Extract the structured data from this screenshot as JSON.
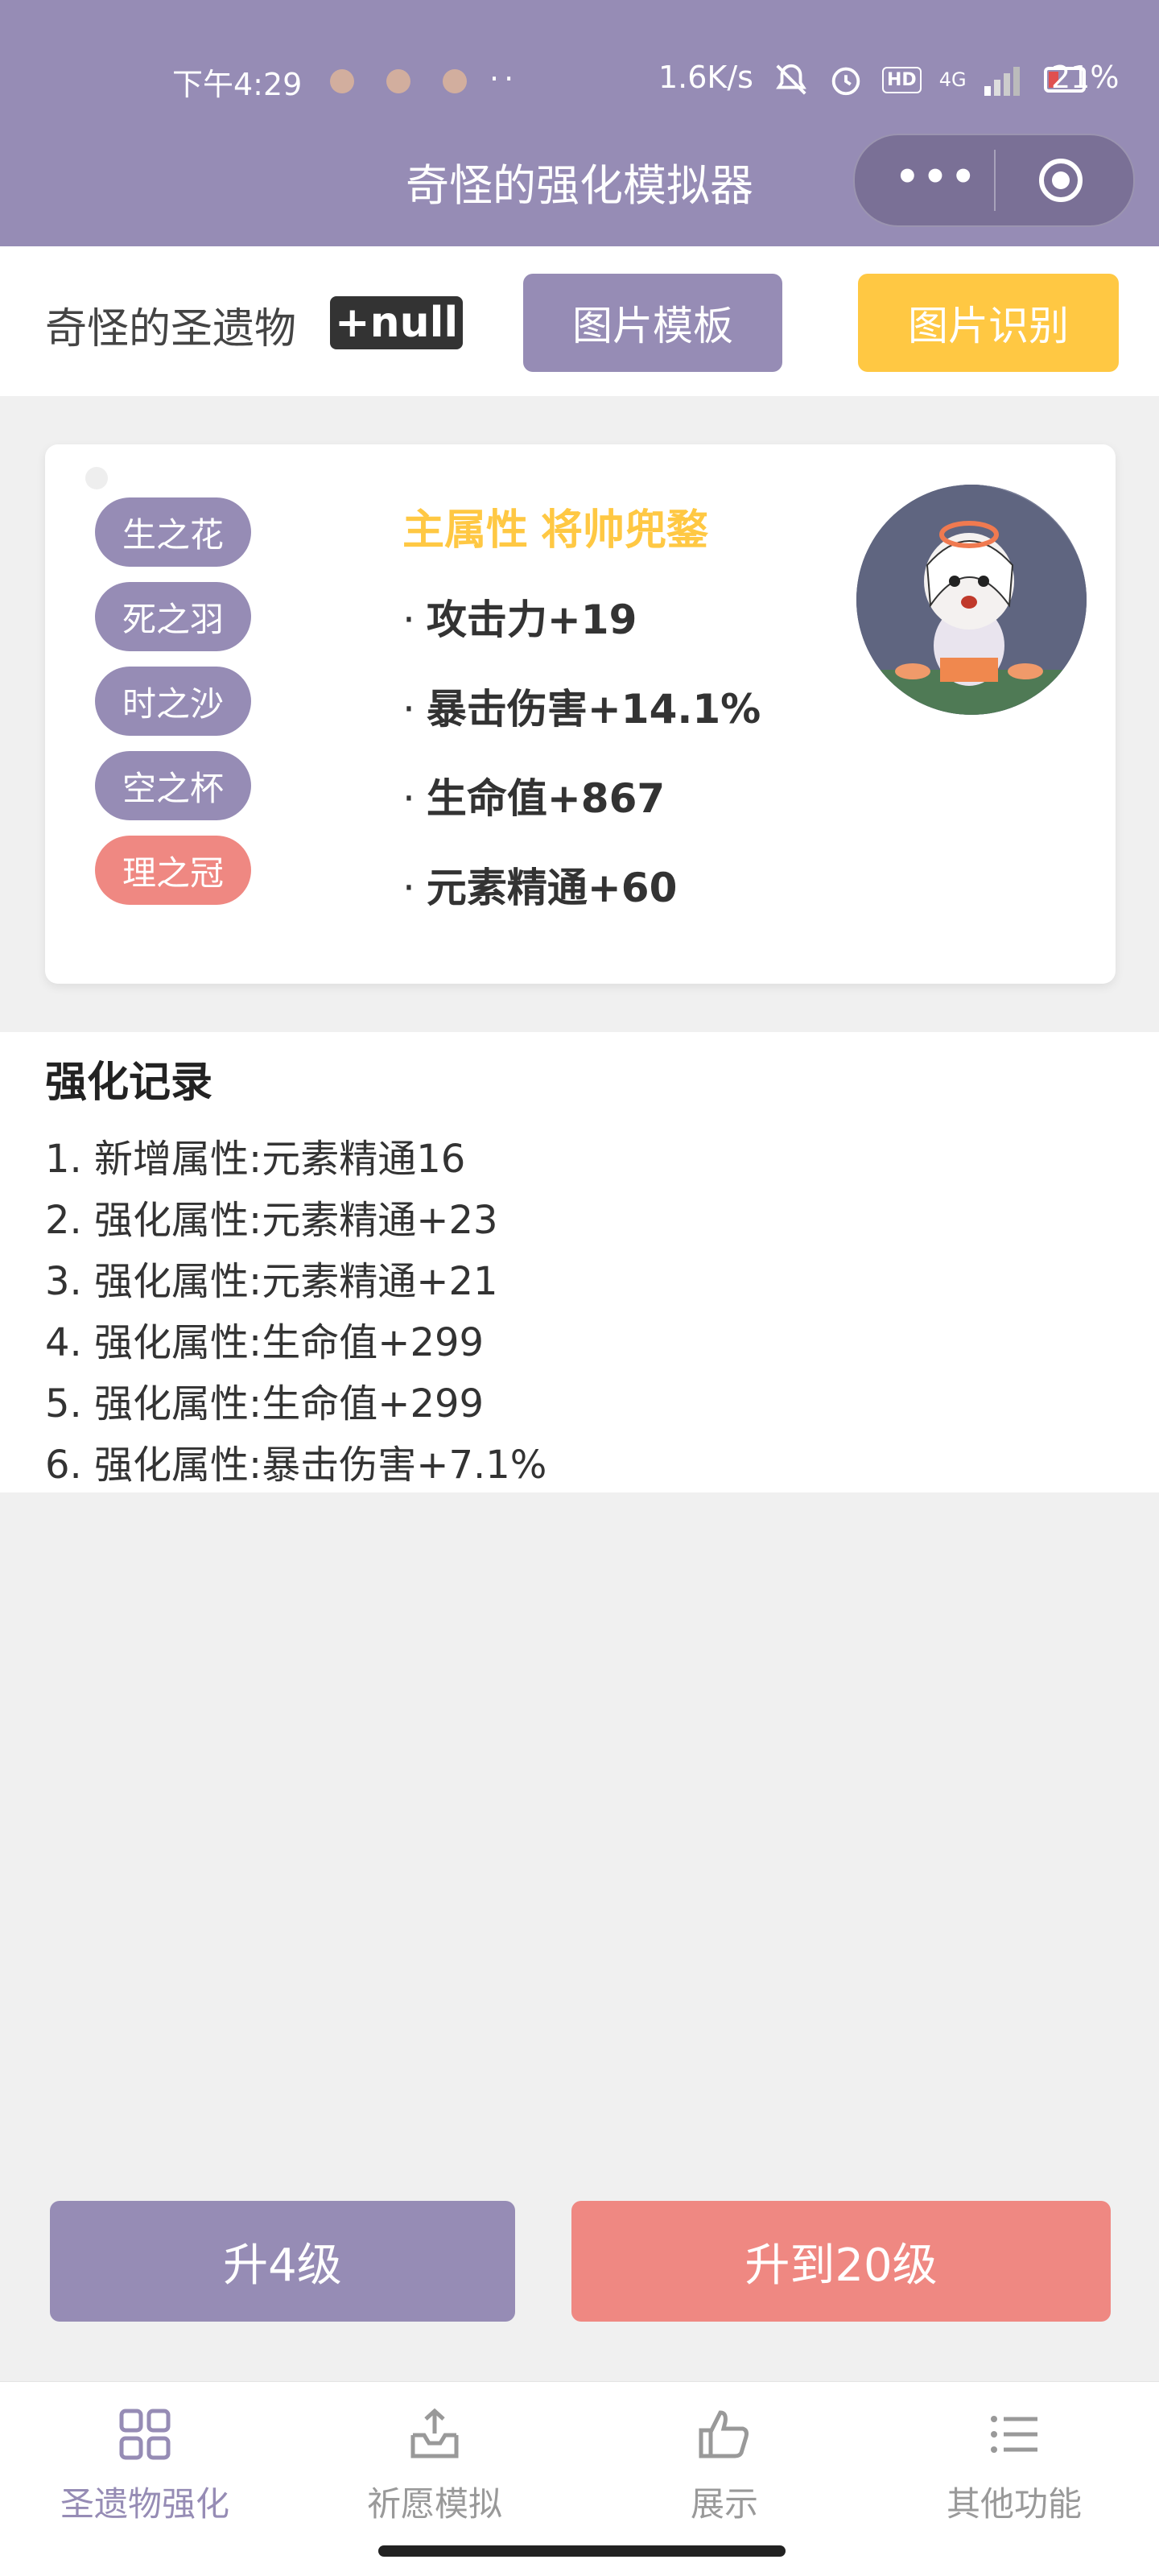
{
  "status_bar": {
    "time": "下午4:29",
    "more": "··",
    "net_speed": "1.6K/s",
    "signal_label": "4G",
    "hd_label": "HD",
    "battery": "21%"
  },
  "nav": {
    "title": "奇怪的强化模拟器",
    "menu_dots": "•••"
  },
  "toolbar": {
    "title": "奇怪的圣遗物",
    "badge": "+null",
    "template_button": "图片模板",
    "recognize_button": "图片识别"
  },
  "card": {
    "slots": [
      "生之花",
      "死之羽",
      "时之沙",
      "空之杯",
      "理之冠"
    ],
    "active_slot_index": 4,
    "main_attr_label": "主属性",
    "main_attr_value": "将帅兜鍪",
    "bullet": "·",
    "sub_attrs": [
      "攻击力+19",
      "暴击伤害+14.1%",
      "生命值+867",
      "元素精通+60"
    ]
  },
  "records": {
    "title": "强化记录",
    "items": [
      "1. 新增属性:元素精通16",
      "2. 强化属性:元素精通+23",
      "3. 强化属性:元素精通+21",
      "4. 强化属性:生命值+299",
      "5. 强化属性:生命值+299",
      "6. 强化属性:暴击伤害+7.1%"
    ]
  },
  "actions": {
    "upgrade_4": "升4级",
    "upgrade_20": "升到20级"
  },
  "tabbar": {
    "tabs": [
      {
        "label": "圣遗物强化",
        "icon": "grid-icon",
        "active": true
      },
      {
        "label": "祈愿模拟",
        "icon": "inbox-upload-icon",
        "active": false
      },
      {
        "label": "展示",
        "icon": "thumbs-up-icon",
        "active": false
      },
      {
        "label": "其他功能",
        "icon": "list-icon",
        "active": false
      }
    ]
  },
  "colors": {
    "primary": "#968cb5",
    "accent_yellow": "#ffc843",
    "accent_red": "#ef8882",
    "background": "#f0f0f0"
  }
}
